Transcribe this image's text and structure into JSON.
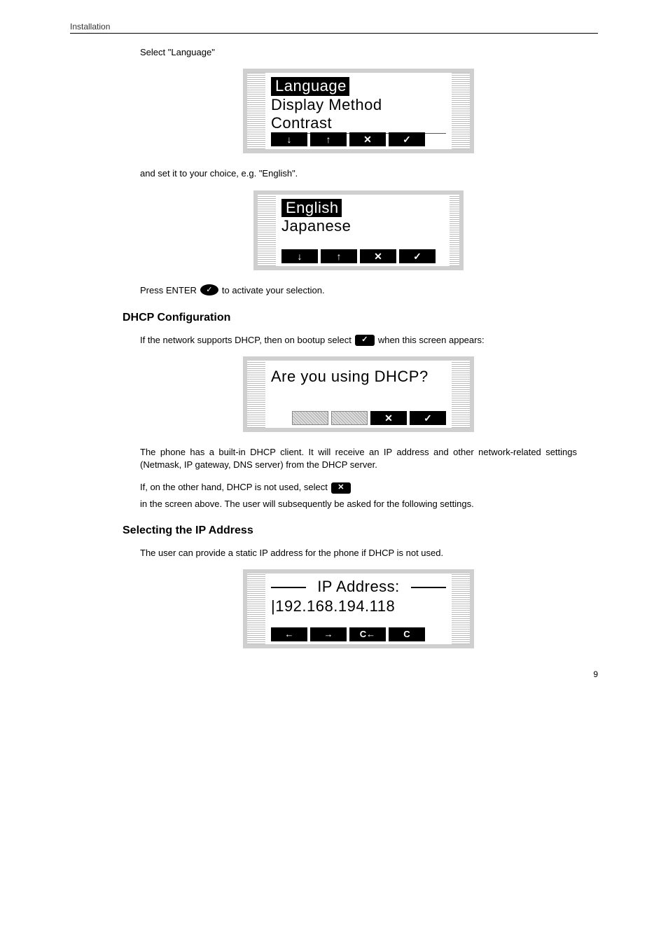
{
  "page": {
    "header": "Installation",
    "number": "9"
  },
  "body": {
    "select_language_text": "Select \"Language\"",
    "set_choice_text": "and set it to your choice, e.g. \"English\".",
    "press_enter_prefix": "Press ENTER",
    "press_enter_suffix": "to activate your selection.",
    "enter_symbol": "✓",
    "dhcp_para1_prefix": "If the network supports DHCP, then on bootup select",
    "dhcp_para1_suffix": "when this screen appears:",
    "dhcp_check_symbol": "✓",
    "dhcp_para2": "The phone has a built-in DHCP client. It will receive an IP address and other network-related settings (Netmask, IP gateway, DNS server) from the DHCP server.",
    "dhcp_para3_prefix": "If, on the other hand, DHCP is not used, select",
    "dhcp_para3_suffix": "in the screen above. The user will subsequently be asked for the following settings.",
    "dhcp_x_symbol": "✕",
    "ip_para": "The user can provide a static IP address for the phone if DHCP is not used."
  },
  "headings": {
    "dhcp": "DHCP Configuration",
    "ip": "Selecting the IP Address"
  },
  "lcd1": {
    "line1": "Language",
    "line2": "Display Method",
    "line3": "Contrast",
    "keys": {
      "down": "↓",
      "up": "↑",
      "x": "✕",
      "ok": "✓"
    }
  },
  "lcd2": {
    "line1": "English",
    "line2": "Japanese",
    "keys": {
      "down": "↓",
      "up": "↑",
      "x": "✕",
      "ok": "✓"
    }
  },
  "lcd3": {
    "line1": "Are you using DHCP?",
    "keys": {
      "x": "✕",
      "ok": "✓"
    }
  },
  "lcd4": {
    "title": "IP Address:",
    "value": "|192.168.194.118",
    "keys": {
      "left": "←",
      "right": "→",
      "back": "C←",
      "clear": "C"
    }
  }
}
